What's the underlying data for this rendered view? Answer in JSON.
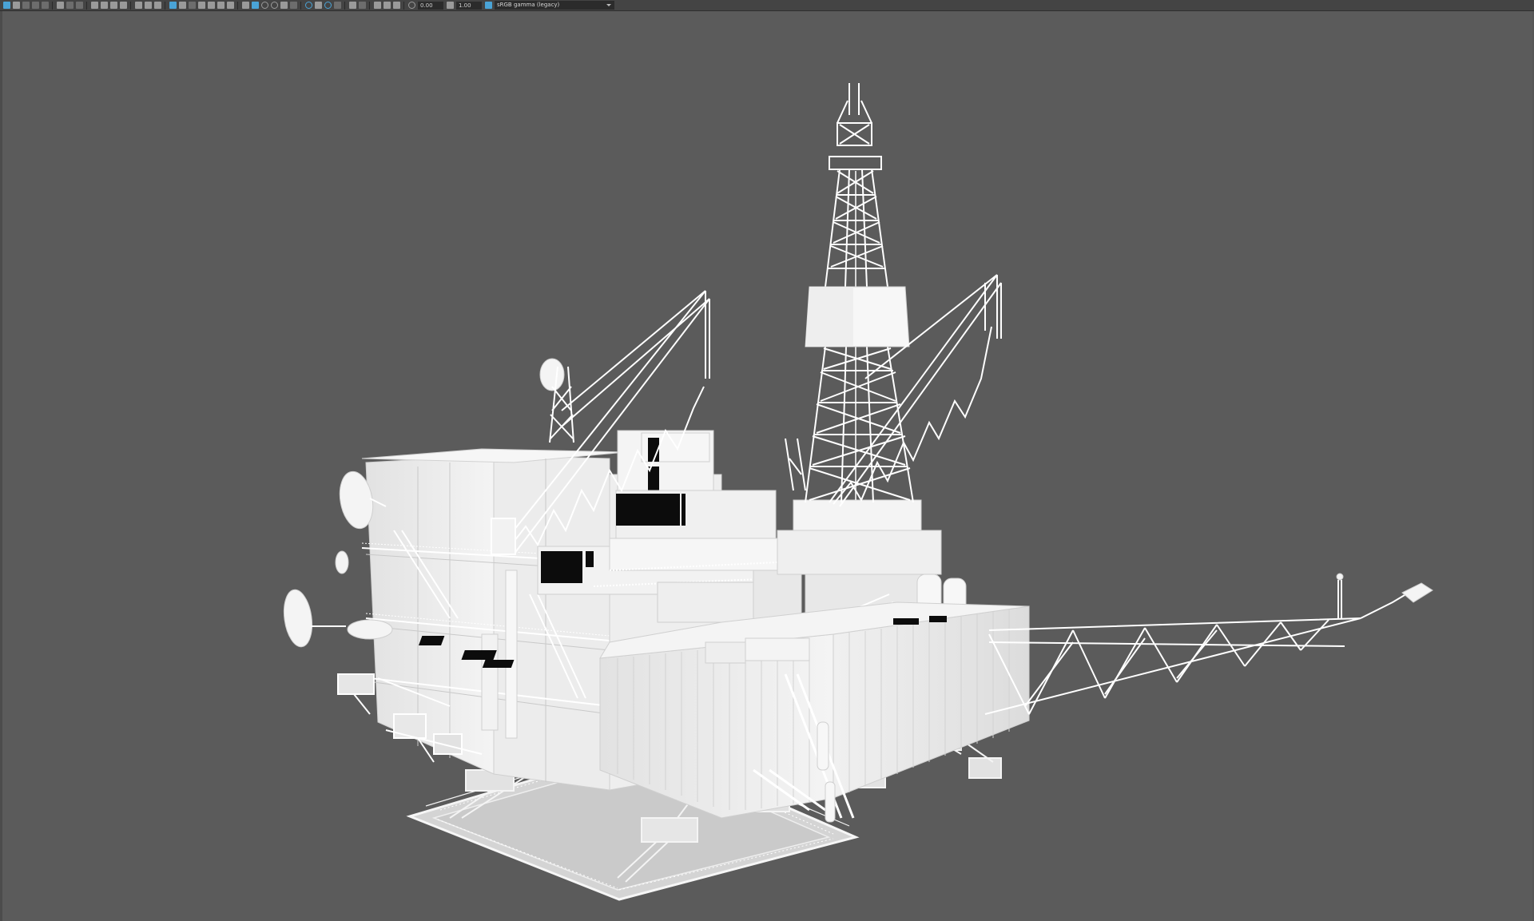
{
  "toolbar": {
    "exposure_value": "0.00",
    "gamma_value": "1.00",
    "colorspace_selected": "sRGB gamma (legacy)",
    "icons_group1": [
      "select-camera-icon",
      "camera-attributes-icon",
      "bookmark-icon",
      "image-plane-icon",
      "view-2d-icon"
    ],
    "icons_group2": [
      "grease-pencil-icon",
      "grid-icon",
      "film-gate-icon",
      "resolution-gate-icon",
      "gate-mask-icon",
      "field-chart-icon",
      "safe-action-icon",
      "safe-title-icon"
    ],
    "icons_group3": [
      "wireframe-icon",
      "smooth-shade-icon",
      "default-material-icon",
      "textured-icon",
      "use-all-lights-icon",
      "shadows-icon",
      "screen-space-ao-icon",
      "motion-blur-icon",
      "anti-aliasing-icon",
      "depth-of-field-icon"
    ],
    "icons_group4": [
      "isolate-select-icon",
      "xray-icon",
      "xray-joints-icon",
      "xray-components-icon"
    ]
  },
  "viewport": {
    "background_color": "#5b5b5b",
    "model_color": "#efefef",
    "subject": "offshore-oil-platform-model"
  }
}
